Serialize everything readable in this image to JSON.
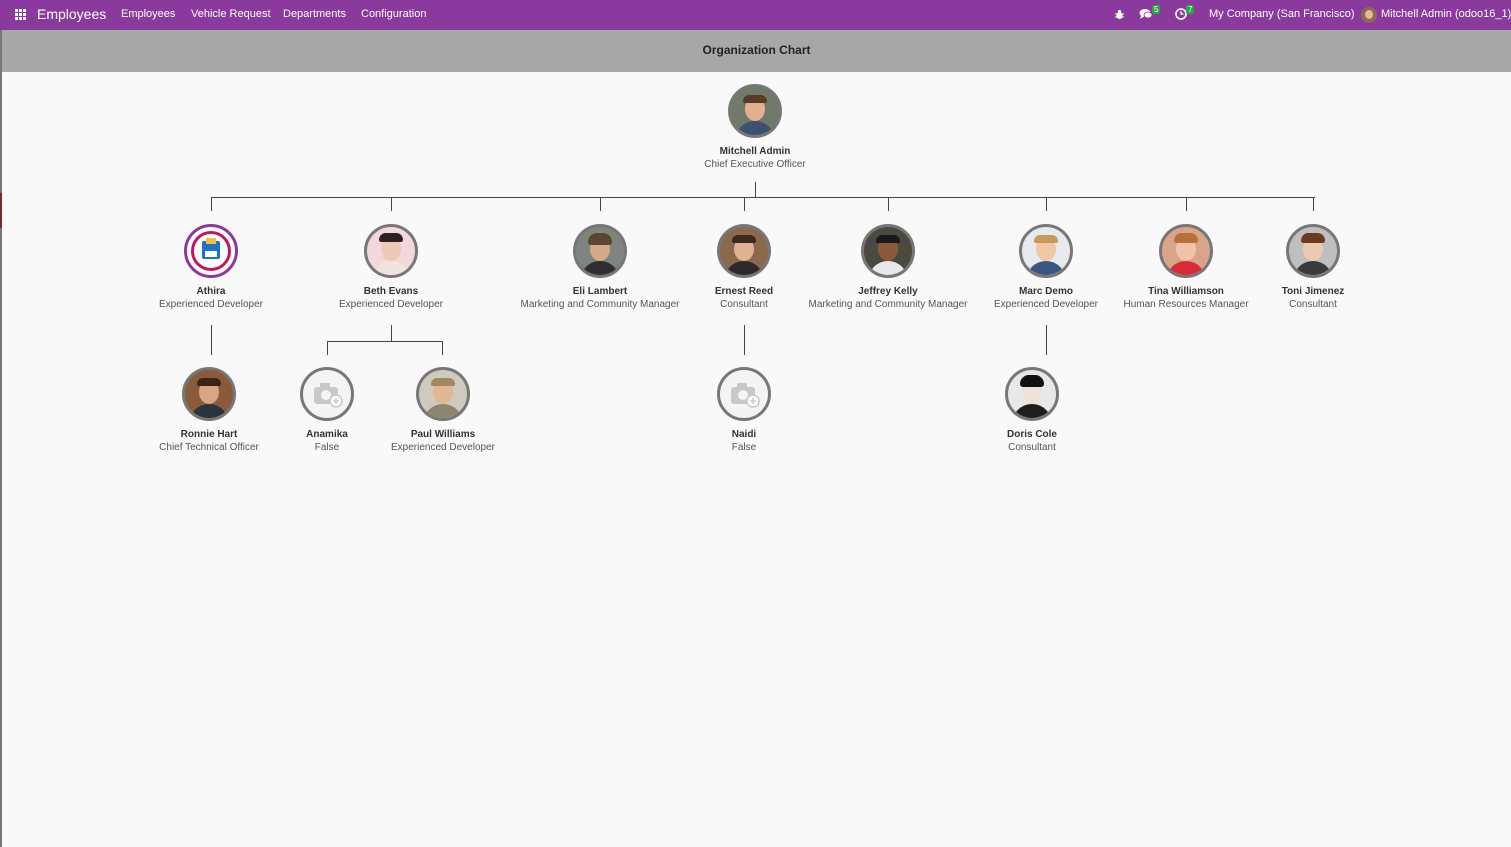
{
  "navbar": {
    "app_title": "Employees",
    "menu": [
      "Employees",
      "Vehicle Request",
      "Departments",
      "Configuration"
    ],
    "messages_count": "5",
    "activities_count": "7",
    "company": "My Company (San Francisco)",
    "user": "Mitchell Admin (odoo16_1)",
    "color": "#8a3a9c"
  },
  "page": {
    "title": "Organization Chart"
  },
  "org": {
    "root": {
      "name": "Mitchell Admin",
      "job": "Chief Executive Officer"
    },
    "level1": [
      {
        "name": "Athira",
        "job": "Experienced Developer"
      },
      {
        "name": "Beth Evans",
        "job": "Experienced Developer"
      },
      {
        "name": "Eli Lambert",
        "job": "Marketing and Community Manager"
      },
      {
        "name": "Ernest Reed",
        "job": "Consultant"
      },
      {
        "name": "Jeffrey Kelly",
        "job": "Marketing and Community Manager"
      },
      {
        "name": "Marc Demo",
        "job": "Experienced Developer"
      },
      {
        "name": "Tina Williamson",
        "job": "Human Resources Manager"
      },
      {
        "name": "Toni Jimenez",
        "job": "Consultant"
      }
    ],
    "level2": [
      {
        "name": "Ronnie Hart",
        "job": "Chief Technical Officer"
      },
      {
        "name": "Anamika",
        "job": "False"
      },
      {
        "name": "Paul Williams",
        "job": "Experienced Developer"
      },
      {
        "name": "Naidi",
        "job": "False"
      },
      {
        "name": "Doris Cole",
        "job": "Consultant"
      }
    ]
  }
}
